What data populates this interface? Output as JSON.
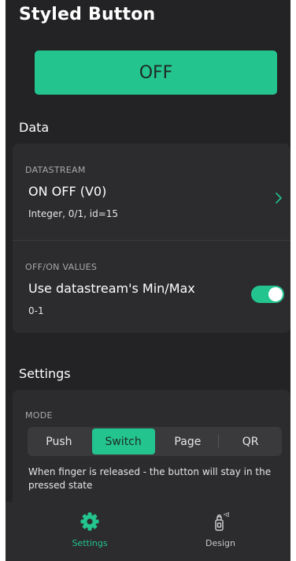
{
  "header": {
    "title": "Styled Button"
  },
  "preview": {
    "button_label": "OFF"
  },
  "data_section": {
    "title": "Data",
    "datastream": {
      "caption": "DATASTREAM",
      "value": "ON OFF (V0)",
      "details": "Integer, 0/1, id=15",
      "chevron_icon": "chevron-right-icon"
    },
    "off_on_values": {
      "caption": "OFF/ON VALUES",
      "value": "Use datastream's Min/Max",
      "details": "0-1",
      "toggle_on": true
    }
  },
  "settings_section": {
    "title": "Settings",
    "mode": {
      "caption": "MODE",
      "options": [
        "Push",
        "Switch",
        "Page",
        "QR"
      ],
      "selected": "Switch",
      "description": "When finger is released - the button will stay in the pressed state"
    }
  },
  "bottom_nav": {
    "items": [
      {
        "label": "Settings",
        "icon": "gear-icon",
        "active": true
      },
      {
        "label": "Design",
        "icon": "spray-can-icon",
        "active": false
      }
    ]
  },
  "colors": {
    "accent": "#23c48e",
    "background": "#232224",
    "card": "#2c2b2e"
  }
}
